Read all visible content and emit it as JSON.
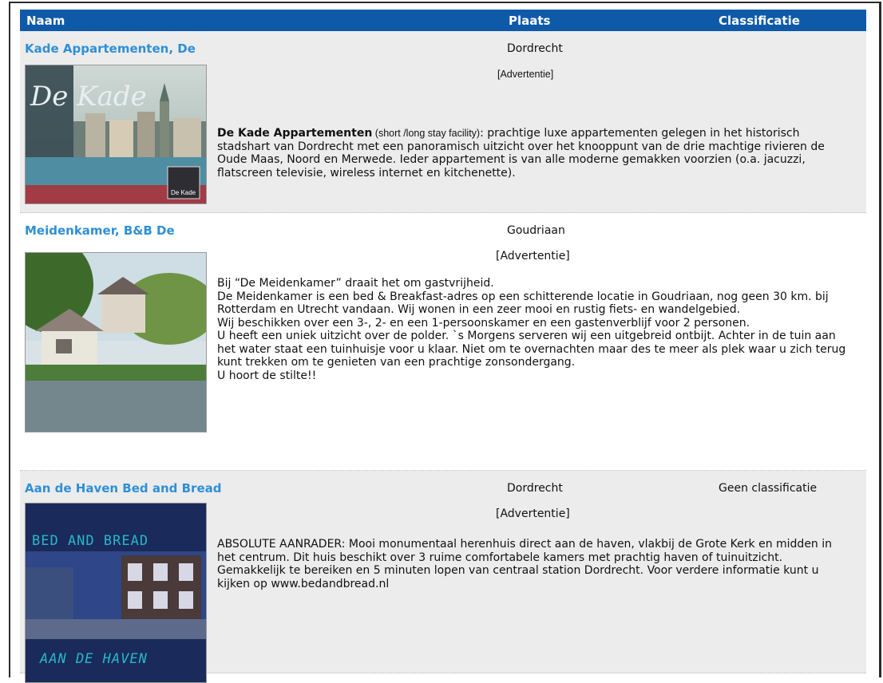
{
  "header": {
    "name": "Naam",
    "place": "Plaats",
    "classification": "Classificatie"
  },
  "rows": [
    {
      "name": "Kade Appartementen, De",
      "place": "Dordrecht",
      "classification": "",
      "ad": "[Advertentie]",
      "image_text": {
        "title": "De Kade",
        "badge": "De Kade"
      },
      "desc_bold": "De Kade Appartementen",
      "desc_small": " (short /long stay facility)",
      "desc_rest": ": prachtige luxe appartementen gelegen in het historisch stadshart van Dordrecht met een panoramisch uitzicht over het knooppunt van de drie machtige rivieren de Oude Maas, Noord en Merwede. Ieder appartement is van alle moderne gemakken voorzien (o.a. jacuzzi, flatscreen televisie, wireless internet en kitchenette)."
    },
    {
      "name": "Meidenkamer, B&B De",
      "place": "Goudriaan",
      "classification": "",
      "ad": "[Advertentie]",
      "desc_lines": [
        "Bij “De Meidenkamer” draait het om gastvrijheid.",
        "De Meidenkamer is een bed & Breakfast-adres op een schitterende locatie in Goudriaan, nog geen 30 km. bij Rotterdam en Utrecht vandaan. Wij wonen in een zeer mooi en rustig fiets- en wandelgebied.",
        "Wij beschikken over een 3-, 2- en een 1-persoonskamer en een gastenverblijf voor 2 personen.",
        "U heeft een uniek uitzicht over de polder. `s Morgens serveren wij een uitgebreid ontbijt. Achter in de tuin aan het water staat een tuinhuisje voor u klaar. Niet om te overnachten maar des te meer als plek waar u zich terug kunt trekken om te genieten van een prachtige zonsondergang.",
        "U hoort de stilte!!"
      ]
    },
    {
      "name": "Aan de Haven Bed and Bread",
      "place": "Dordrecht",
      "classification": "Geen classificatie",
      "ad": "[Advertentie]",
      "image_text": {
        "top": "BED AND BREAD",
        "bottom": "AAN DE HAVEN"
      },
      "desc": "ABSOLUTE AANRADER: Mooi monumentaal herenhuis direct aan de haven, vlakbij de Grote Kerk en midden in het centrum. Dit huis beschikt over 3 ruime comfortabele kamers met prachtig haven of tuinuitzicht. Gemakkelijk te bereiken en 5 minuten lopen van centraal station Dordrecht. Voor verdere informatie kunt u kijken op www.bedandbread.nl"
    }
  ]
}
